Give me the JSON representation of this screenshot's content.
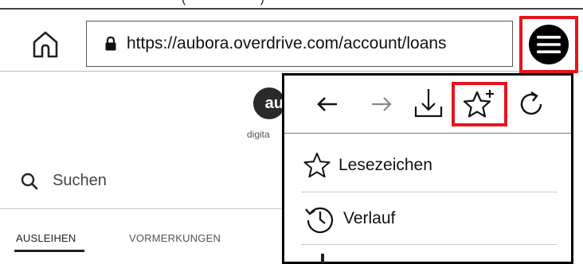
{
  "browser": {
    "url": "https://aubora.overdrive.com/account/loans",
    "icons": {
      "home": "home-icon",
      "lock": "lock-icon",
      "menu": "hamburger-menu-icon"
    }
  },
  "page": {
    "logo_text": "au",
    "logo_sub": "digita",
    "search_label": "Suchen",
    "tabs": [
      {
        "label": "AUSLEIHEN",
        "active": true
      },
      {
        "label": "VORMERKUNGEN",
        "active": false
      }
    ]
  },
  "menu": {
    "nav_icons": [
      "back-arrow-icon",
      "forward-arrow-icon",
      "download-icon",
      "add-bookmark-icon",
      "reload-icon"
    ],
    "items": [
      {
        "label": "Lesezeichen",
        "icon": "star-icon"
      },
      {
        "label": "Verlauf",
        "icon": "history-icon"
      }
    ]
  },
  "colors": {
    "highlight": "#e8141c",
    "text": "#111111"
  }
}
